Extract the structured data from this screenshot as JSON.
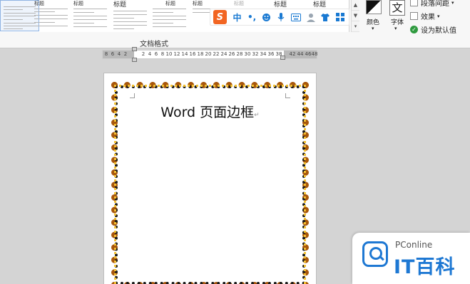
{
  "ribbon": {
    "styles_gallery": [
      {
        "title": "",
        "selected": true
      },
      {
        "title": "标题"
      },
      {
        "title": "标题"
      },
      {
        "title": "标题"
      },
      {
        "title": "标题"
      },
      {
        "title": "标题"
      },
      {
        "title": "标题"
      },
      {
        "title": "标题"
      },
      {
        "title": "标题"
      }
    ],
    "section_label": "文档格式",
    "colors_label": "颜色",
    "font_label": "字体",
    "font_icon_glyph": "文",
    "paragraph_spacing": "段落间距",
    "effects": "效果",
    "set_default": "设为默认值"
  },
  "ime_toolbar": {
    "logo": "S",
    "mode": "中",
    "punct": "•,",
    "icons": [
      "emoji-icon",
      "microphone-icon",
      "keyboard-icon",
      "skin-icon",
      "shirt-icon",
      "toolbox-icon"
    ]
  },
  "ruler": {
    "labels": [
      "8",
      "6",
      "4",
      "2",
      "2",
      "4",
      "6",
      "8",
      "10",
      "12",
      "14",
      "16",
      "18",
      "20",
      "22",
      "24",
      "26",
      "28",
      "30",
      "32",
      "34",
      "36",
      "38",
      "42",
      "44",
      "46",
      "48"
    ]
  },
  "document": {
    "title": "Word 页面边框",
    "paragraph_mark": "↵"
  },
  "watermark": {
    "brand": "PConline",
    "name": "IT百科"
  },
  "colors": {
    "border_primary": "#a8570b",
    "border_secondary": "#f3c130",
    "watermark_blue": "#1e78d3",
    "ime_orange": "#f26522"
  }
}
